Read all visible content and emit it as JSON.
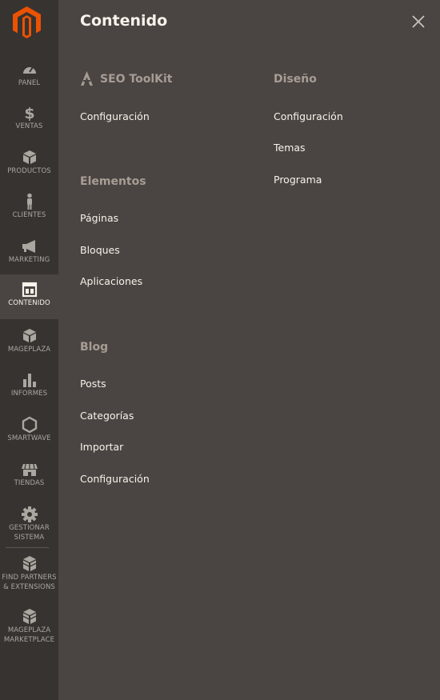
{
  "sidebar": {
    "items": [
      {
        "label": "PANEL",
        "icon": "dashboard-icon"
      },
      {
        "label": "VENTAS",
        "icon": "dollar-icon"
      },
      {
        "label": "PRODUCTOS",
        "icon": "box-icon"
      },
      {
        "label": "CLIENTES",
        "icon": "person-icon"
      },
      {
        "label": "MARKETING",
        "icon": "megaphone-icon"
      },
      {
        "label": "CONTENIDO",
        "icon": "layout-icon",
        "active": true
      },
      {
        "label": "MAGEPLAZA",
        "icon": "cube-icon"
      },
      {
        "label": "INFORMES",
        "icon": "bar-chart-icon"
      },
      {
        "label": "SMARTWAVE",
        "icon": "hexagon-icon"
      },
      {
        "label": "TIENDAS",
        "icon": "store-icon"
      },
      {
        "label": "GESTIONAR\nSISTEMA",
        "icon": "gear-icon"
      },
      {
        "label": "FIND PARTNERS\n& EXTENSIONS",
        "icon": "blocks-icon"
      },
      {
        "label": "MAGEPLAZA\nMARKETPLACE",
        "icon": "blocks-icon"
      }
    ]
  },
  "panel": {
    "title": "Contenido",
    "sections": {
      "seo": {
        "title": "SEO ToolKit",
        "links": [
          "Configuración"
        ]
      },
      "elementos": {
        "title": "Elementos",
        "links": [
          "Páginas",
          "Bloques",
          "Aplicaciones"
        ]
      },
      "blog": {
        "title": "Blog",
        "links": [
          "Posts",
          "Categorías",
          "Importar",
          "Configuración"
        ]
      },
      "diseno": {
        "title": "Diseño",
        "links": [
          "Configuración",
          "Temas",
          "Programa"
        ]
      }
    }
  },
  "colors": {
    "sidebar_bg": "#373330",
    "panel_bg": "#4a4542",
    "logo": "#eb5202",
    "text_light": "#f7f3eb",
    "section_title": "#a79d95"
  }
}
